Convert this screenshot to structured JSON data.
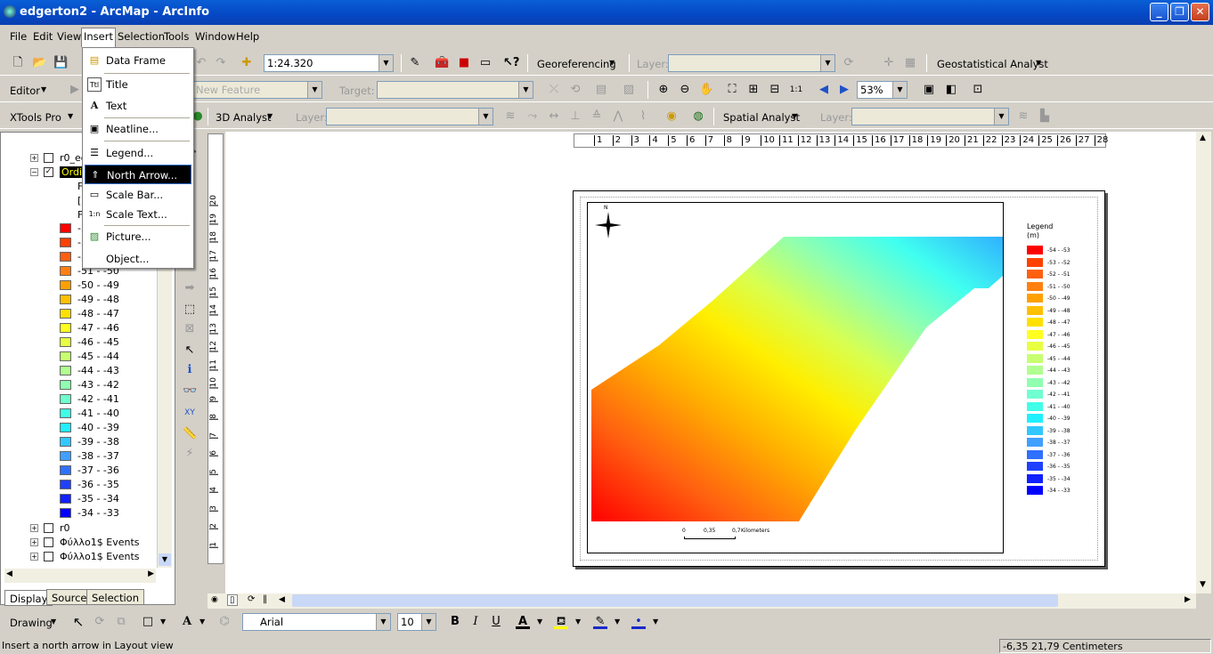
{
  "window": {
    "title": "edgerton2 - ArcMap - ArcInfo",
    "controls": [
      "minimize",
      "maximize",
      "close"
    ]
  },
  "menubar": [
    "File",
    "Edit",
    "View",
    "Insert",
    "Selection",
    "Tools",
    "Window",
    "Help"
  ],
  "toolbar1": {
    "scale": "1:24.320",
    "georef": "Georeferencing",
    "layer_label": "Layer:",
    "geostat": "Geostatistical Analyst"
  },
  "toolbar2": {
    "editor": "Editor",
    "task": "New Feature",
    "target_label": "Target:",
    "zoom": "53%"
  },
  "toolbar3": {
    "xtools": "XTools Pro",
    "analyst3d": "3D Analyst",
    "layer_label": "Layer:",
    "spatial": "Spatial Analyst",
    "layer_label2": "Layer:"
  },
  "insert_menu": {
    "items": [
      "Data Frame",
      "Title",
      "Text",
      "Neatline...",
      "Legend...",
      "North Arrow...",
      "Scale Bar...",
      "Scale Text...",
      "Picture...",
      "Object..."
    ],
    "highlighted": "North Arrow..."
  },
  "toc": {
    "layers_top": [
      "r0_ed",
      "Ordin"
    ],
    "sublabels": [
      "F",
      "[",
      "F"
    ],
    "classes": [
      "-54 - -53",
      "-53 - -52",
      "-52 - -51",
      "-51 - -50",
      "-50 - -49",
      "-49 - -48",
      "-48 - -47",
      "-47 - -46",
      "-46 - -45",
      "-45 - -44",
      "-44 - -43",
      "-43 - -42",
      "-42 - -41",
      "-41 - -40",
      "-40 - -39",
      "-39 - -38",
      "-38 - -37",
      "-37 - -36",
      "-36 - -35",
      "-35 - -34",
      "-34 - -33"
    ],
    "class_colors": [
      "#ff0000",
      "#ff4000",
      "#ff6010",
      "#ff8010",
      "#ffa000",
      "#ffc000",
      "#ffe000",
      "#ffff20",
      "#e8ff40",
      "#c8ff70",
      "#b0ff90",
      "#90ffb0",
      "#70ffd0",
      "#40ffe8",
      "#20f0ff",
      "#30c8ff",
      "#40a0ff",
      "#3070ff",
      "#2040ff",
      "#1020ff",
      "#0000ff"
    ],
    "layers_bottom": [
      "r0",
      "Φύλλο1$ Events",
      "Φύλλο1$ Events"
    ],
    "tabs": [
      "Display",
      "Source",
      "Selection"
    ]
  },
  "ruler_h": [
    "1",
    "2",
    "3",
    "4",
    "5",
    "6",
    "7",
    "8",
    "9",
    "10",
    "11",
    "12",
    "13",
    "14",
    "15",
    "16",
    "17",
    "18",
    "19",
    "20",
    "21",
    "22",
    "23",
    "24",
    "25",
    "26",
    "27",
    "28"
  ],
  "ruler_v": [
    "20",
    "19",
    "18",
    "17",
    "16",
    "15",
    "14",
    "13",
    "12",
    "11",
    "10",
    "9",
    "8",
    "7",
    "6",
    "5",
    "4",
    "3",
    "2",
    "1"
  ],
  "layout": {
    "legend_title": "Legend",
    "legend_unit": "(m)",
    "legend_labels": [
      "-54 - -53",
      "-53 - -52",
      "-52 - -51",
      "-51 - -50",
      "-50 - -49",
      "-49 - -48",
      "-48 - -47",
      "-47 - -46",
      "-46 - -45",
      "-45 - -44",
      "-44 - -43",
      "-43 - -42",
      "-42 - -41",
      "-41 - -40",
      "-40 - -39",
      "-39 - -38",
      "-38 - -37",
      "-37 - -36",
      "-36 - -35",
      "-35 - -34",
      "-34 - -33"
    ],
    "scalebar": {
      "t0": "0",
      "t1": "0,35",
      "t2": "0,7",
      "unit": "Kilometers"
    },
    "north": "N"
  },
  "drawing": {
    "label": "Drawing",
    "font": "Arial",
    "size": "10"
  },
  "status": {
    "message": "Insert a north arrow in Layout view",
    "coords": "-6,35  21,79 Centimeters"
  }
}
